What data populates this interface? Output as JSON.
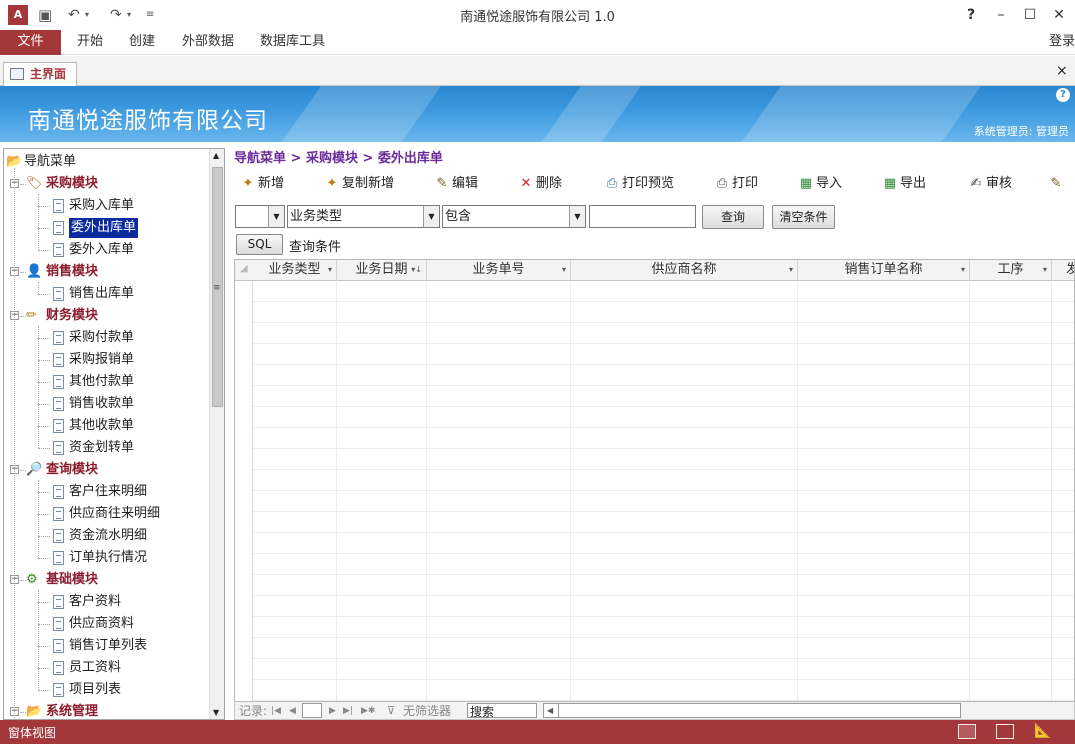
{
  "window": {
    "title": "南通悦途服饰有限公司 1.0",
    "help": "?",
    "minimize": "–",
    "maximize": "☐",
    "close": "✕",
    "login": "登录"
  },
  "ribbon": {
    "tabs": [
      "文件",
      "开始",
      "创建",
      "外部数据",
      "数据库工具"
    ]
  },
  "document_tab": {
    "label": "主界面",
    "close": "×"
  },
  "banner": {
    "title": "南通悦途服饰有限公司",
    "user": "系统管理员: 管理员"
  },
  "nav": {
    "root": "导航菜单",
    "modules": [
      {
        "label": "采购模块",
        "icon": "purchase-icon",
        "items": [
          "采购入库单",
          "委外出库单",
          "委外入库单"
        ],
        "selected": "委外出库单"
      },
      {
        "label": "销售模块",
        "icon": "sales-icon",
        "items": [
          "销售出库单"
        ]
      },
      {
        "label": "财务模块",
        "icon": "finance-icon",
        "items": [
          "采购付款单",
          "采购报销单",
          "其他付款单",
          "销售收款单",
          "其他收款单",
          "资金划转单"
        ]
      },
      {
        "label": "查询模块",
        "icon": "query-icon",
        "items": [
          "客户往来明细",
          "供应商往来明细",
          "资金流水明细",
          "订单执行情况"
        ]
      },
      {
        "label": "基础模块",
        "icon": "base-icon",
        "items": [
          "客户资料",
          "供应商资料",
          "销售订单列表",
          "员工资料",
          "项目列表"
        ]
      },
      {
        "label": "系统管理",
        "icon": "folder-icon",
        "items": []
      }
    ]
  },
  "breadcrumb": "导航菜单 > 采购模块 > 委外出库单",
  "toolbar": {
    "new": "新增",
    "copy_new": "复制新增",
    "edit": "编辑",
    "delete": "删除",
    "print_preview": "打印预览",
    "print": "打印",
    "import": "导入",
    "export": "导出",
    "audit": "审核"
  },
  "filter": {
    "field": "业务类型",
    "operator": "包含",
    "value": "",
    "query_button": "查询",
    "clear_button": "清空条件",
    "sql_button": "SQL",
    "sql_label": "查询条件"
  },
  "grid": {
    "columns": [
      "业务类型",
      "业务日期",
      "业务单号",
      "供应商名称",
      "销售订单名称",
      "工序",
      "发"
    ]
  },
  "record_nav": {
    "label": "记录:",
    "current": "",
    "no_filter": "无筛选器",
    "search": "搜索"
  },
  "status": {
    "text": "窗体视图"
  },
  "colors": {
    "accent": "#a4373a",
    "banner": "#2a86cf",
    "module_label": "#8b1d2d",
    "breadcrumb": "#6b2b9a",
    "selection": "#0a2a9e"
  }
}
